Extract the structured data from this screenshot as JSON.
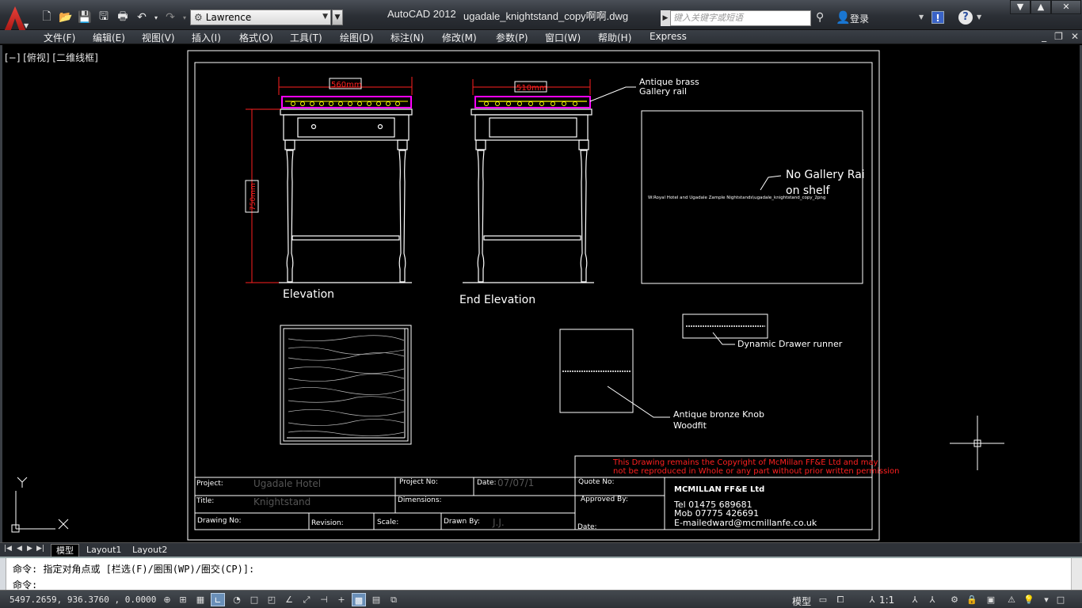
{
  "titlebar": {
    "workspace": "Lawrence",
    "app_title": "AutoCAD 2012",
    "file_title": "ugadale_knightstand_copy啊啊.dwg",
    "search_placeholder": "键入关键字或短语",
    "login": "登录"
  },
  "menu": [
    "文件(F)",
    "编辑(E)",
    "视图(V)",
    "插入(I)",
    "格式(O)",
    "工具(T)",
    "绘图(D)",
    "标注(N)",
    "修改(M)",
    "参数(P)",
    "窗口(W)",
    "帮助(H)",
    "Express"
  ],
  "viewport_label": "[−] [俯视] [二维线框]",
  "drawing": {
    "dim_width_front": "560mm",
    "dim_width_end": "510mm",
    "dim_height": "750mm",
    "label_elevation": "Elevation",
    "label_end_elevation": "End Elevation",
    "note_gallery": "Antique brass",
    "note_gallery_2": "Gallery rail",
    "note_no_gallery": "No Gallery Rai",
    "note_no_gallery_2": "on shelf",
    "image_path": "W:Royal Hotel and Ugadale Zample Nightstands\\ugadale_knightstand_copy_2png",
    "note_runner": "Dynamic Drawer runner",
    "note_knob": "Antique bronze Knob",
    "note_knob_2": "Woodfit",
    "copyright_1": "This Drawing remains the Copyright of McMillan FF&E Ltd and may",
    "copyright_2": "not be reproduced in Whole or any part without prior written permission",
    "tb_project_label": "Project:",
    "tb_project": "Ugadale Hotel",
    "tb_project_no": "Project No:",
    "tb_date_label": "Date:",
    "tb_date": "07/07/1",
    "tb_quote": "Quote No:",
    "tb_title_label": "Title:",
    "tb_title": "Knightstand",
    "tb_dimensions": "Dimensions:",
    "tb_approved": "Approved By:",
    "tb_drawing_no": "Drawing No:",
    "tb_revision": "Revision:",
    "tb_scale": "Scale:",
    "tb_drawn_by": "Drawn By:",
    "tb_drawn_by_val": "J.J.",
    "tb_date2": "Date:",
    "company": "MCMILLAN FF&E Ltd",
    "tel": "Tel       01475  689681",
    "mob": "Mob     07775  426691",
    "email": "E-mailedward@mcmillanfe.co.uk"
  },
  "ucs": {
    "x": "X",
    "y": "Y"
  },
  "tabs": [
    "模型",
    "Layout1",
    "Layout2"
  ],
  "command": {
    "history": "命令: 指定对角点或 [栏选(F)/圈围(WP)/圈交(CP)]:",
    "prompt": "命令:"
  },
  "status": {
    "coords": "5497.2659, 936.3760 , 0.0000",
    "model": "模型",
    "scale": "1:1"
  },
  "colors": {
    "magenta": "#ff00ff",
    "yellow": "#ffff00",
    "red": "#ff2020",
    "linework": "#ffffff"
  }
}
